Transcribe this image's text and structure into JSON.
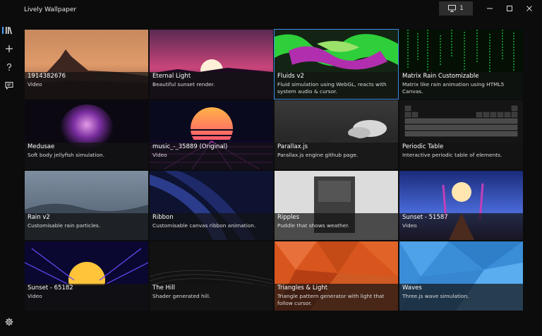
{
  "app": {
    "title": "Lively Wallpaper"
  },
  "titlebar": {
    "display_label": "1",
    "minimize": "–",
    "maximize": "☐",
    "close": "✕"
  },
  "sidebar": {
    "items": [
      {
        "name": "library"
      },
      {
        "name": "add"
      },
      {
        "name": "help"
      },
      {
        "name": "feedback"
      }
    ],
    "settings": "settings"
  },
  "tiles": [
    {
      "title": "1914382676",
      "desc": "Video"
    },
    {
      "title": "Eternal Light",
      "desc": "Beautiful sunset render."
    },
    {
      "title": "Fluids v2",
      "desc": "Fluid simulation using WebGL, reacts with system audio & cursor."
    },
    {
      "title": "Matrix Rain Customizable",
      "desc": "Matrix like rain animation using HTML5 Canvas."
    },
    {
      "title": "Medusae",
      "desc": "Soft body jellyfish simulation."
    },
    {
      "title": "music_-_35889 (Original)",
      "desc": "Video"
    },
    {
      "title": "Parallax.js",
      "desc": "Parallax.js engine github page."
    },
    {
      "title": "Periodic Table",
      "desc": "Interactive periodic table of elements."
    },
    {
      "title": "Rain v2",
      "desc": "Customisable rain particles."
    },
    {
      "title": "Ribbon",
      "desc": "Customisable canvas ribbon animation."
    },
    {
      "title": "Ripples",
      "desc": "Puddle that shows weather."
    },
    {
      "title": "Sunset - 51587",
      "desc": "Video"
    },
    {
      "title": "Sunset - 65182",
      "desc": "Video"
    },
    {
      "title": "The Hill",
      "desc": "Shader generated hill."
    },
    {
      "title": "Triangles & Light",
      "desc": "Triangle pattern generator with light that follow cursor."
    },
    {
      "title": "Waves",
      "desc": "Three.js wave simulation."
    }
  ],
  "accent_color": "#3c8de8"
}
